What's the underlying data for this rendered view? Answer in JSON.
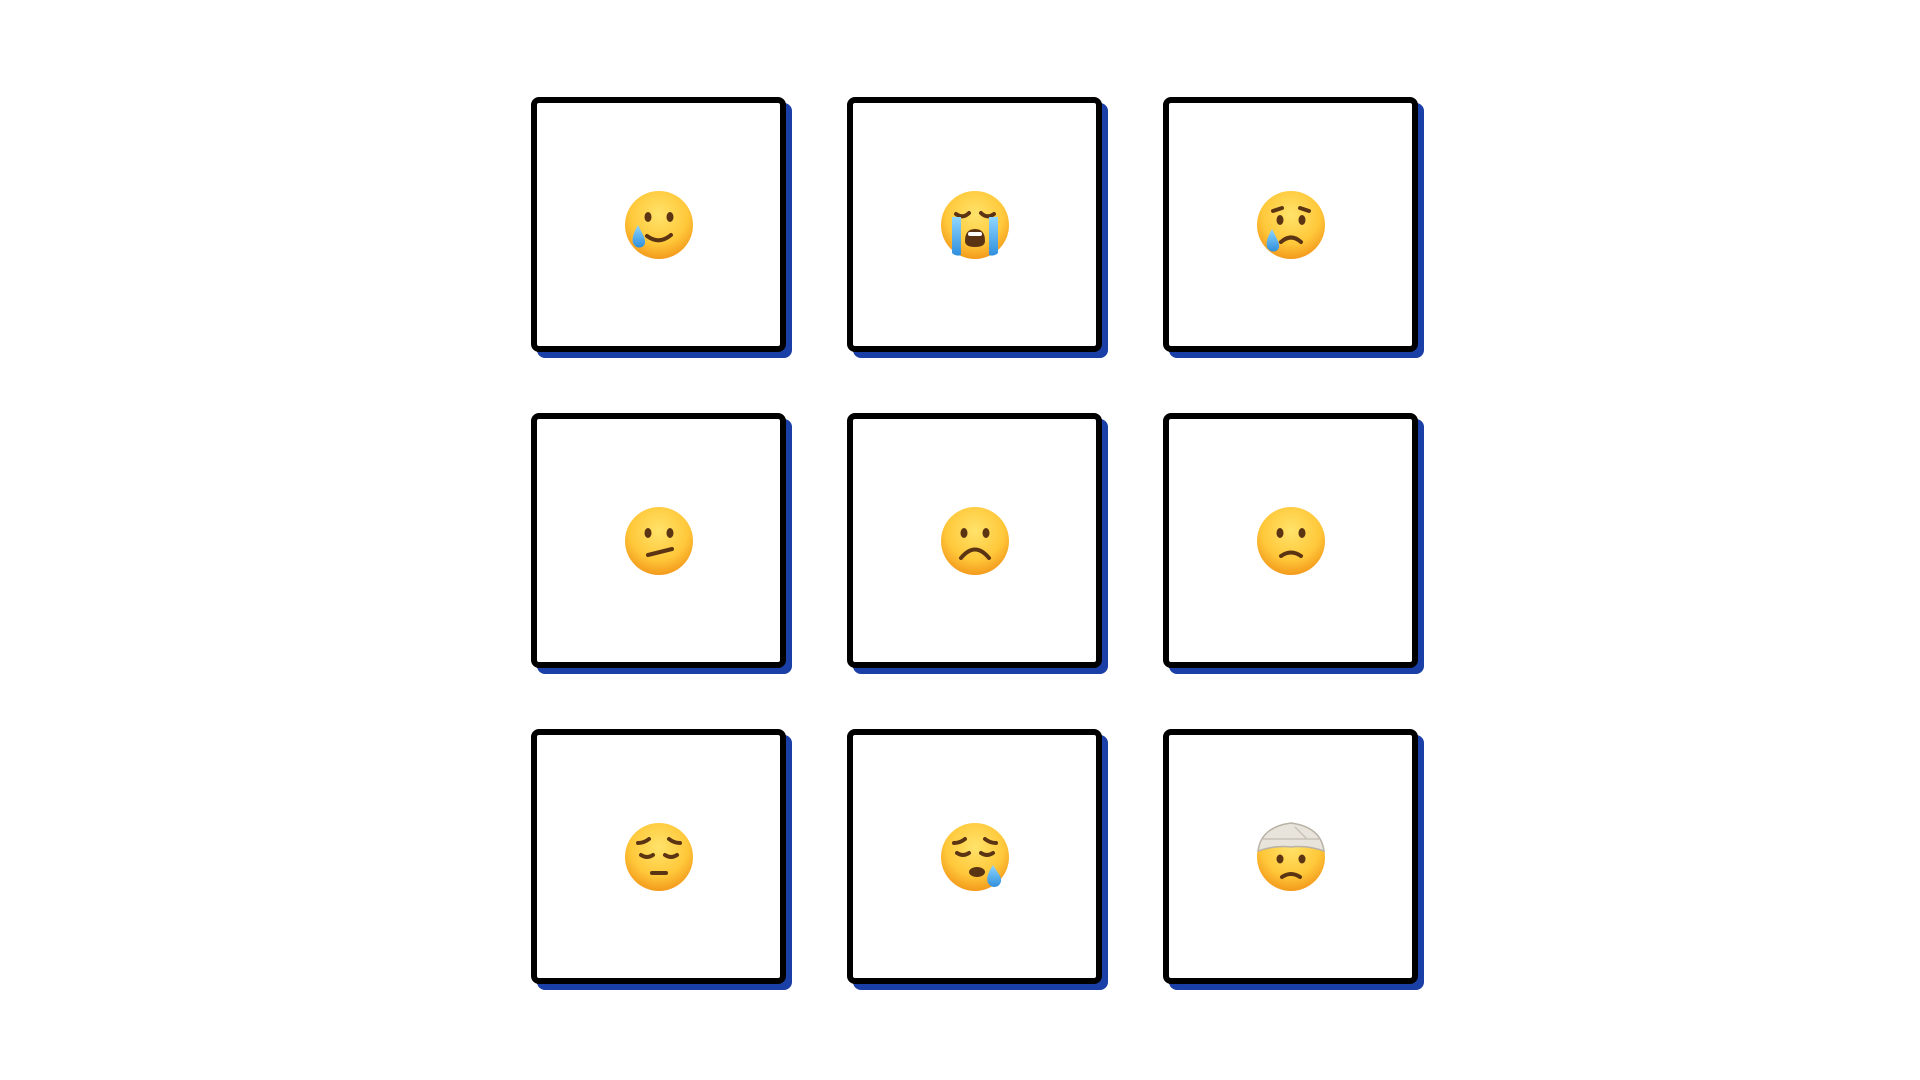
{
  "colors": {
    "tile_border": "#000000",
    "tile_shadow": "#1a3fa6",
    "background": "#ffffff",
    "face": "#ffc83a",
    "tear": "#4fb3ef"
  },
  "tiles": [
    {
      "icon": "smiling-face-with-tear-icon"
    },
    {
      "icon": "loudly-crying-face-icon"
    },
    {
      "icon": "crying-face-icon"
    },
    {
      "icon": "confused-face-icon"
    },
    {
      "icon": "frowning-face-icon"
    },
    {
      "icon": "slightly-frowning-face-icon"
    },
    {
      "icon": "pensive-face-icon"
    },
    {
      "icon": "sleepy-face-icon"
    },
    {
      "icon": "face-with-head-bandage-icon"
    }
  ]
}
